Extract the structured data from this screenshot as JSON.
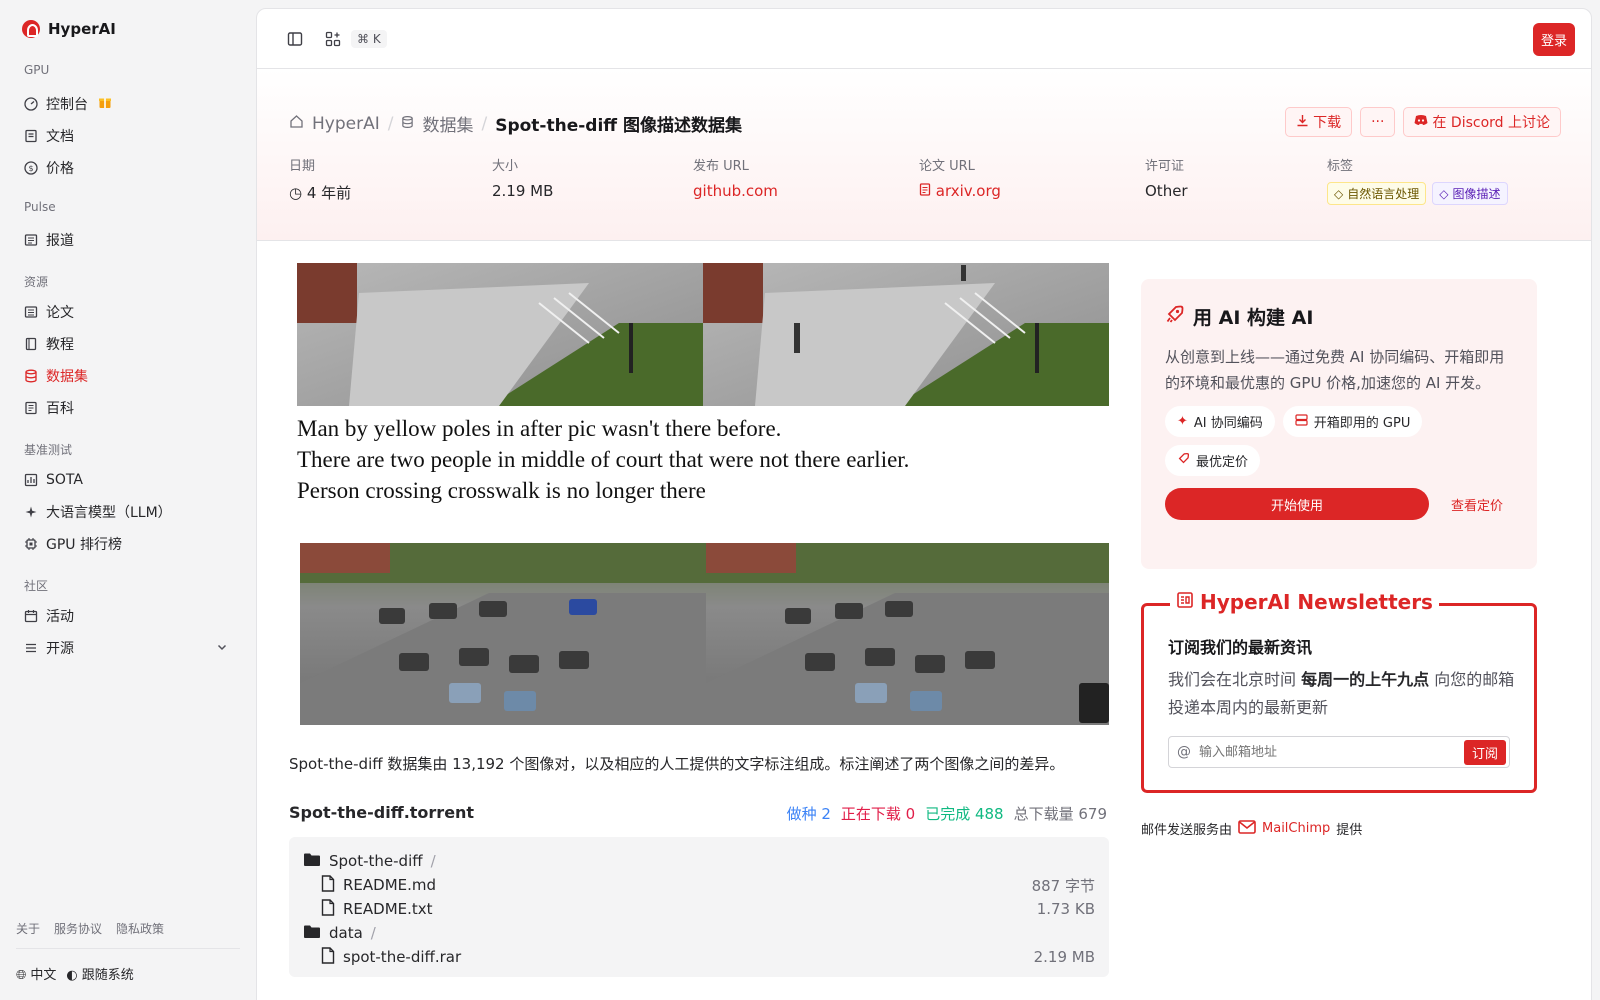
{
  "brand": "HyperAI",
  "sidebar": {
    "sections": [
      {
        "title": "GPU",
        "items": [
          {
            "label": "控制台"
          },
          {
            "label": "文档"
          },
          {
            "label": "价格"
          }
        ]
      },
      {
        "title": "Pulse",
        "items": [
          {
            "label": "报道"
          }
        ]
      },
      {
        "title": "资源",
        "items": [
          {
            "label": "论文"
          },
          {
            "label": "教程"
          },
          {
            "label": "数据集"
          },
          {
            "label": "百科"
          }
        ]
      },
      {
        "title": "基准测试",
        "items": [
          {
            "label": "SOTA"
          },
          {
            "label": "大语言模型（LLM）"
          },
          {
            "label": "GPU 排行榜"
          }
        ]
      },
      {
        "title": "社区",
        "items": [
          {
            "label": "活动"
          },
          {
            "label": "开源"
          }
        ]
      }
    ],
    "footer_links": [
      "关于",
      "服务协议",
      "隐私政策"
    ],
    "language": "中文",
    "theme": "跟随系统"
  },
  "topbar": {
    "shortcut": "⌘ K",
    "login": "登录"
  },
  "breadcrumb": {
    "home": "HyperAI",
    "section": "数据集",
    "current": "Spot-the-diff 图像描述数据集"
  },
  "actions": {
    "download": "下载",
    "more": "···",
    "discord": "在 Discord 上讨论"
  },
  "meta": {
    "date_label": "日期",
    "date_value": "4 年前",
    "size_label": "大小",
    "size_value": "2.19 MB",
    "release_label": "发布 URL",
    "release_value": "github.com",
    "paper_label": "论文 URL",
    "paper_value": "arxiv.org",
    "license_label": "许可证",
    "license_value": "Other",
    "tags_label": "标签",
    "tags": [
      "自然语言处理",
      "图像描述"
    ]
  },
  "hero_captions": [
    "Man by yellow poles in after pic wasn't there before.",
    "There are two people in middle of court that were not there earlier.",
    "Person crossing crosswalk is no longer there"
  ],
  "description": "Spot-the-diff 数据集由 13,192 个图像对，以及相应的人工提供的文字标注组成。标注阐述了两个图像之间的差异。",
  "torrent": {
    "title": "Spot-the-diff.torrent",
    "seeding": "做种 2",
    "downloading": "正在下载 0",
    "completed": "已完成 488",
    "total": "总下载量 679",
    "files": [
      {
        "name": "Spot-the-diff",
        "type": "folder",
        "size": ""
      },
      {
        "name": "README.md",
        "type": "file",
        "size": "887 字节"
      },
      {
        "name": "README.txt",
        "type": "file",
        "size": "1.73 KB"
      },
      {
        "name": "data",
        "type": "folder",
        "size": ""
      },
      {
        "name": "spot-the-diff.rar",
        "type": "file",
        "size": "2.19 MB"
      }
    ]
  },
  "promo": {
    "title": "用 AI 构建 AI",
    "body": "从创意到上线——通过免费 AI 协同编码、开箱即用的环境和最优惠的 GPU 价格,加速您的 AI 开发。",
    "chips": [
      "AI 协同编码",
      "开箱即用的 GPU",
      "最优定价"
    ],
    "start": "开始使用",
    "pricing": "查看定价"
  },
  "newsletter": {
    "legend": "HyperAI Newsletters",
    "title": "订阅我们的最新资讯",
    "body_pre": "我们会在北京时间 ",
    "body_bold": "每周一的上午九点",
    "body_post": " 向您的邮箱投递本周内的最新更新",
    "placeholder": "输入邮箱地址",
    "subscribe": "订阅"
  },
  "mail_by": {
    "pre": "邮件发送服务由",
    "provider": "MailChimp",
    "post": "提供"
  },
  "colors": {
    "accent": "#dc2626"
  }
}
